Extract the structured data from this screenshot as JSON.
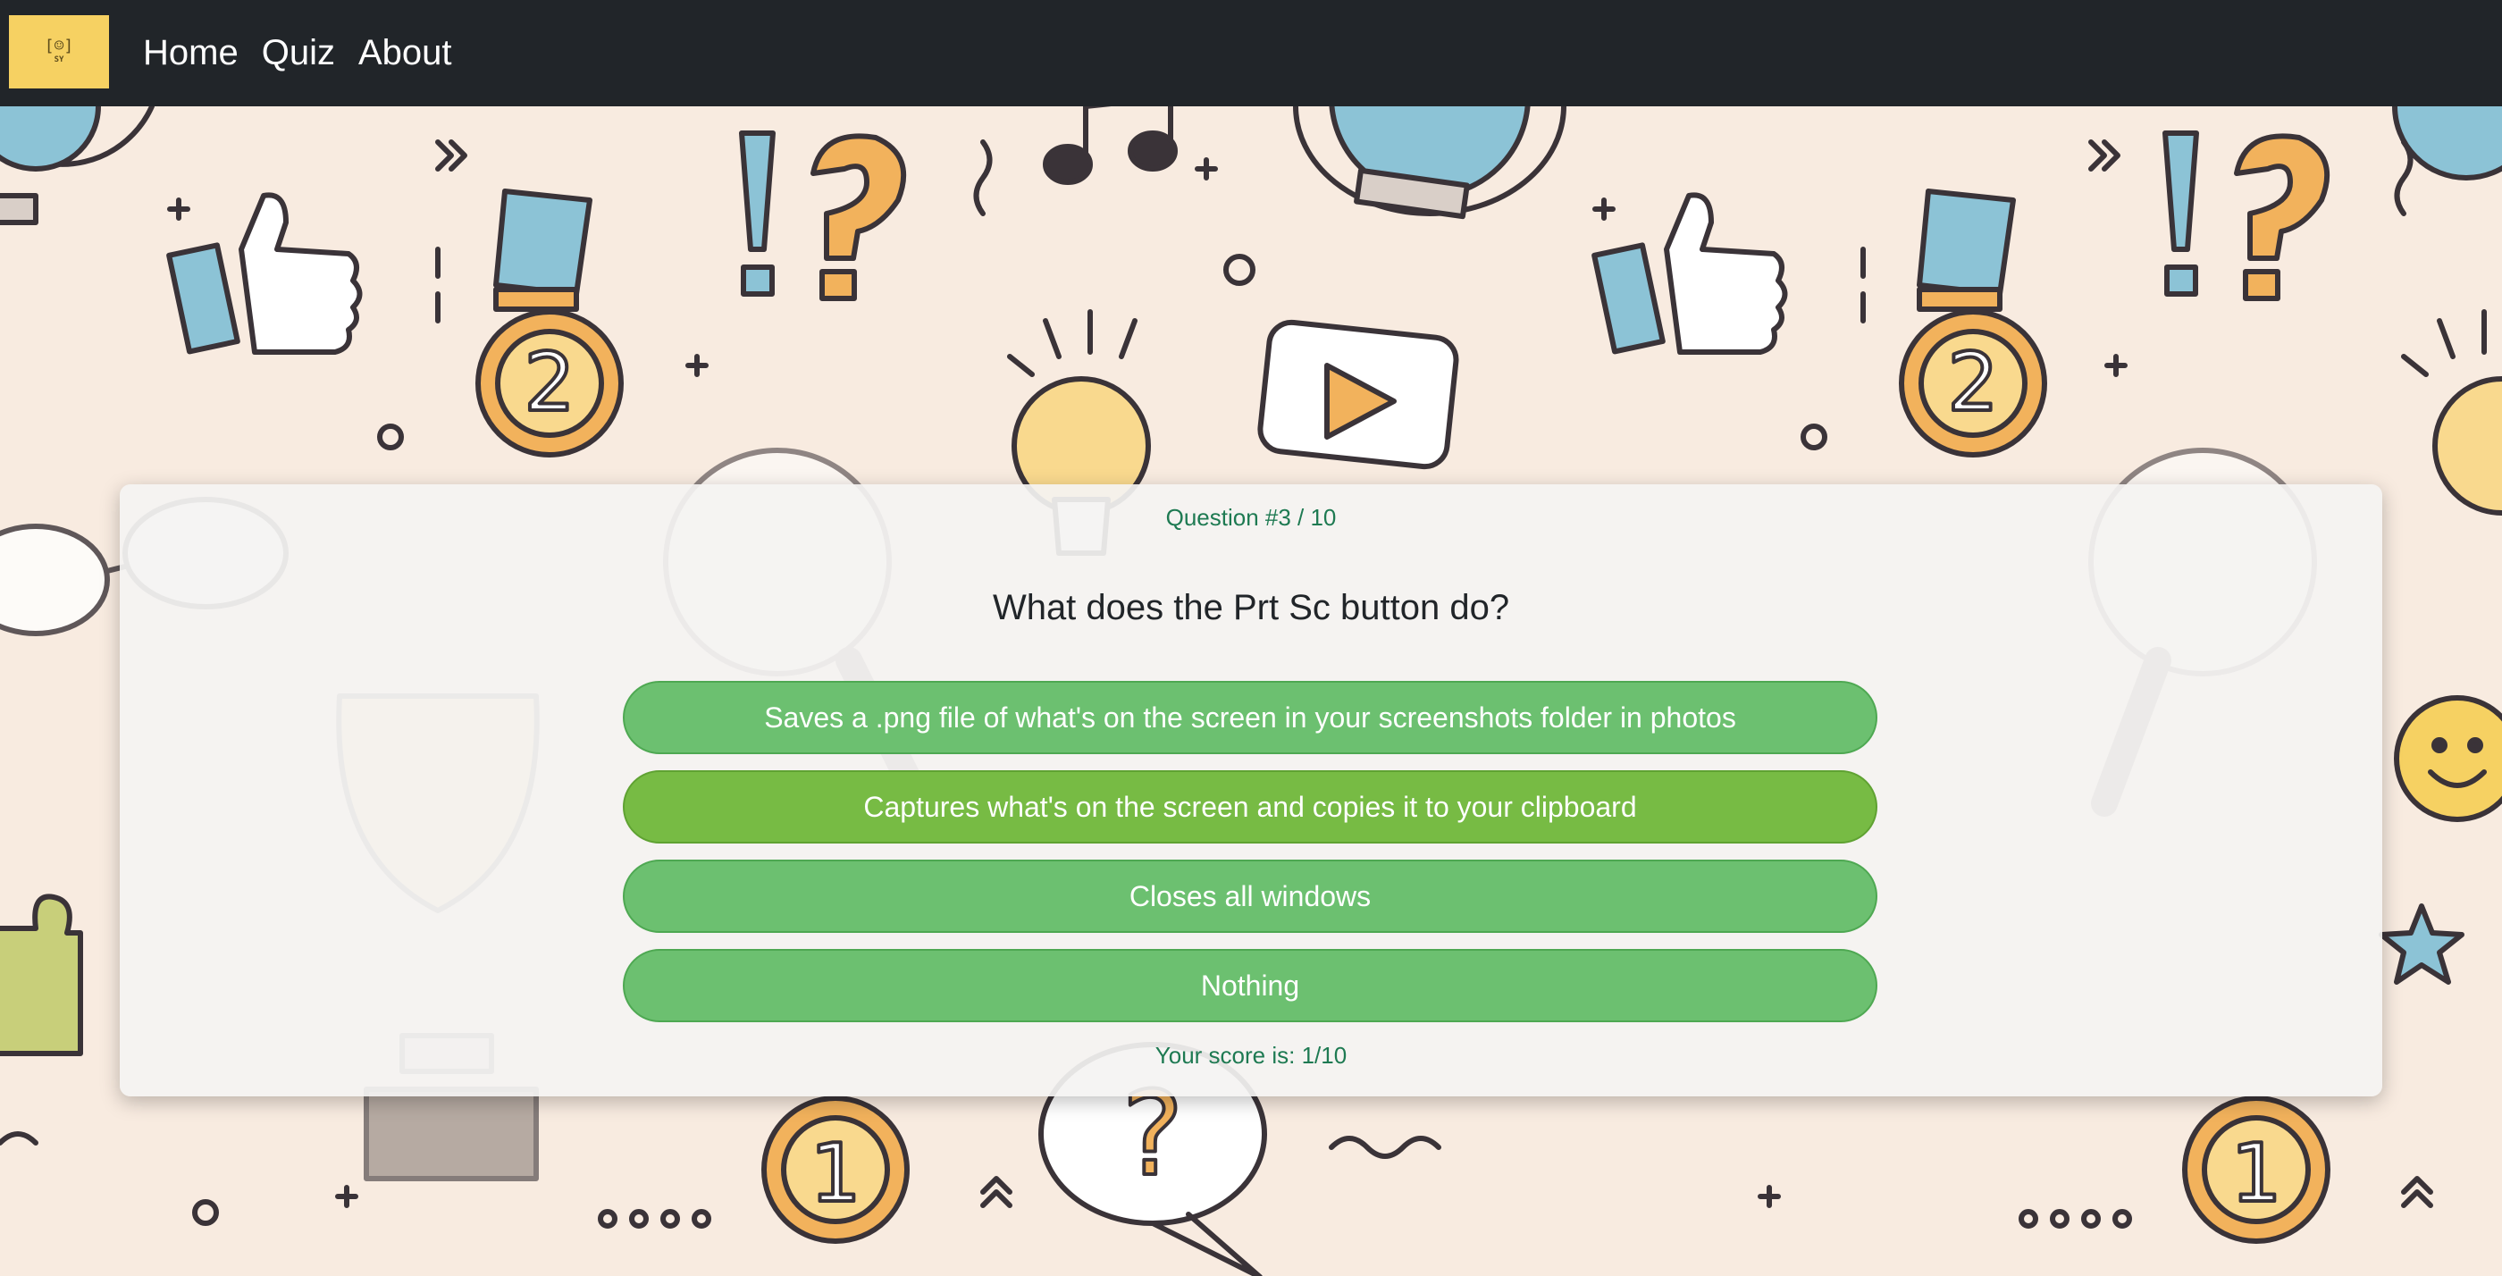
{
  "nav": {
    "logo_text": "SY",
    "links": [
      "Home",
      "Quiz",
      "About"
    ]
  },
  "quiz": {
    "question_number": "Question #3 / 10",
    "question": "What does the Prt Sc button do?",
    "answers": [
      "Saves a .png file of what's on the screen in your screenshots folder in photos",
      "Captures what's on the screen and copies it to your clipboard",
      "Closes all windows",
      "Nothing"
    ],
    "score": "Your score is: 1/10"
  },
  "colors": {
    "navbar": "#212529",
    "logo": "#f6d162",
    "page_background": "#f8ebe0",
    "answer_button": "#6cc070",
    "answer_button_hover": "#77bb44",
    "accent_text": "#1e7a52"
  }
}
